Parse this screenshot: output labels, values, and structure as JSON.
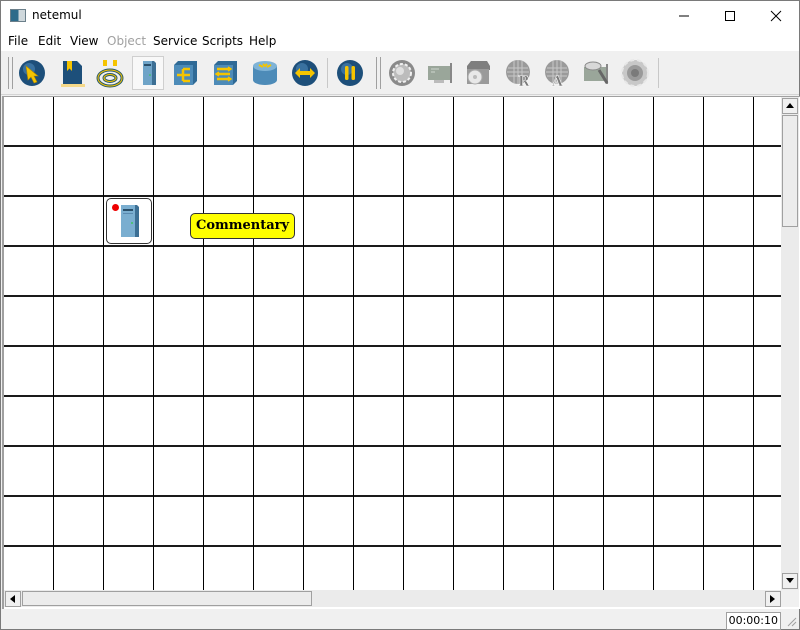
{
  "window": {
    "title": "netemul",
    "controls": [
      "minimize",
      "maximize",
      "close"
    ]
  },
  "menubar": {
    "items": [
      {
        "label": "File",
        "enabled": true
      },
      {
        "label": "Edit",
        "enabled": true
      },
      {
        "label": "View",
        "enabled": true
      },
      {
        "label": "Object",
        "enabled": false
      },
      {
        "label": "Service",
        "enabled": true
      },
      {
        "label": "Scripts",
        "enabled": true
      },
      {
        "label": "Help",
        "enabled": true
      }
    ]
  },
  "toolbar": {
    "group1": [
      {
        "icon": "pointer-icon",
        "active": false,
        "enabled": true
      },
      {
        "icon": "text-note-icon",
        "active": false,
        "enabled": true
      },
      {
        "icon": "cable-icon",
        "active": false,
        "enabled": true
      },
      {
        "icon": "computer-icon",
        "active": true,
        "enabled": true
      },
      {
        "icon": "hub-icon",
        "active": false,
        "enabled": true
      },
      {
        "icon": "switch-icon",
        "active": false,
        "enabled": true
      },
      {
        "icon": "router-icon",
        "active": false,
        "enabled": true
      },
      {
        "icon": "move-icon",
        "active": false,
        "enabled": true
      },
      {
        "icon": "pause-icon",
        "active": false,
        "enabled": true
      }
    ],
    "group2": [
      {
        "icon": "settings-gear-icon",
        "enabled": false
      },
      {
        "icon": "network-card-icon",
        "enabled": false
      },
      {
        "icon": "disk-icon",
        "enabled": false
      },
      {
        "icon": "routing-table-icon",
        "enabled": false,
        "letter": "R"
      },
      {
        "icon": "arp-table-icon",
        "enabled": false,
        "letter": "A"
      },
      {
        "icon": "card-inspect-icon",
        "enabled": false
      },
      {
        "icon": "programs-gear-icon",
        "enabled": false
      }
    ]
  },
  "canvas": {
    "devices": [
      {
        "type": "computer",
        "status": "off"
      }
    ],
    "comments": [
      {
        "text": "Commentary"
      }
    ]
  },
  "statusbar": {
    "timer": "00:00:10"
  },
  "colors": {
    "comment_bg": "#ffff00",
    "led_off": "#e00000",
    "icon_blue": "#1d4f7a",
    "icon_yellow": "#f5c400"
  }
}
